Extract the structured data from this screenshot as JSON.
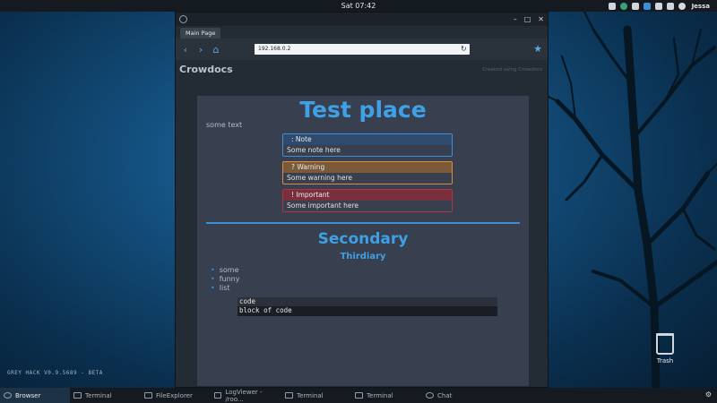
{
  "topbar": {
    "clock": "Sat 07:42",
    "user": "Jessa"
  },
  "desktop": {
    "version": "GREY HACK V0.9.5689 - BETA",
    "trash_label": "Trash"
  },
  "browser": {
    "tab_label": "Main Page",
    "url": "192.168.0.2",
    "site_title": "Crowdocs",
    "site_credit": "Created using Crowdocs"
  },
  "page": {
    "h1": "Test place",
    "intro": "some text",
    "callouts": [
      {
        "icon": ":",
        "title": "Note",
        "body": "Some note here",
        "color": "#3b8fd8"
      },
      {
        "icon": "?",
        "title": "Warning",
        "body": "Some warning here",
        "color": "#d98f3e"
      },
      {
        "icon": "!",
        "title": "Important",
        "body": "Some important here",
        "color": "#b3333e"
      }
    ],
    "h2": "Secondary",
    "h3": "Thirdiary",
    "list": [
      "some",
      "funny",
      "list"
    ],
    "code": [
      "code",
      "block of code"
    ]
  },
  "taskbar": {
    "items": [
      {
        "label": "Browser",
        "icon": "globe-icon",
        "active": true
      },
      {
        "label": "Terminal",
        "icon": "terminal-icon",
        "active": false
      },
      {
        "label": "FileExplorer",
        "icon": "folder-icon",
        "active": false
      },
      {
        "label": "LogViewer - /roo...",
        "icon": "log-icon",
        "active": false
      },
      {
        "label": "Terminal",
        "icon": "terminal-icon",
        "active": false
      },
      {
        "label": "Terminal",
        "icon": "terminal-icon",
        "active": false
      },
      {
        "label": "Chat",
        "icon": "chat-icon",
        "active": false
      }
    ]
  },
  "colors": {
    "accent": "#3ea1e8",
    "content_bg": "#383f4e",
    "window_bg": "#232b34"
  }
}
